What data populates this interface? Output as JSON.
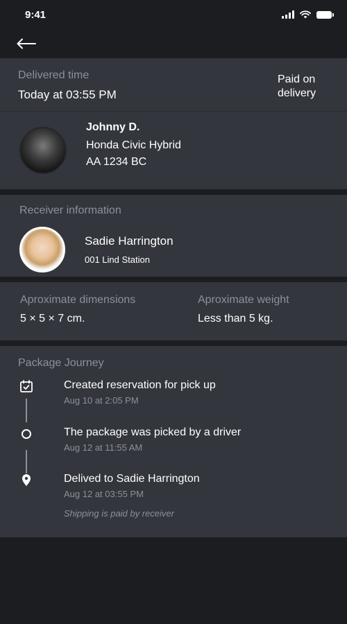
{
  "status_bar": {
    "time": "9:41",
    "icons": [
      "signal-icon",
      "wifi-icon",
      "battery-icon"
    ]
  },
  "top_bar": {
    "back_icon": "arrow-left-icon"
  },
  "delivery": {
    "label": "Delivered time",
    "value": "Today at 03:55 PM",
    "payment_note": "Paid on delivery"
  },
  "driver": {
    "name": "Johnny D.",
    "vehicle": "Honda Civic Hybrid",
    "plate": "AA 1234 BC"
  },
  "receiver": {
    "section_label": "Receiver information",
    "name": "Sadie Harrington",
    "address": "001 Lind Station"
  },
  "package": {
    "dimensions_label": "Aproximate dimensions",
    "dimensions_value": "5 × 5 × 7 cm.",
    "weight_label": "Aproximate weight",
    "weight_value": "Less than 5 kg."
  },
  "journey": {
    "title": "Package Journey",
    "steps": [
      {
        "icon": "calendar-check-icon",
        "title": "Created reservation for pick up",
        "time": "Aug 10 at 2:05 PM"
      },
      {
        "icon": "circle-icon",
        "title": "The package was picked by a driver",
        "time": "Aug 12 at 11:55 AM"
      },
      {
        "icon": "location-pin-icon",
        "title": "Delived to Sadie Harrington",
        "time": "Aug 12 at 03:55 PM"
      }
    ],
    "note": "Shipping is paid by receiver"
  },
  "colors": {
    "background": "#1c1d21",
    "card": "#34363d",
    "muted_text": "#8e9098",
    "text": "#ffffff"
  }
}
